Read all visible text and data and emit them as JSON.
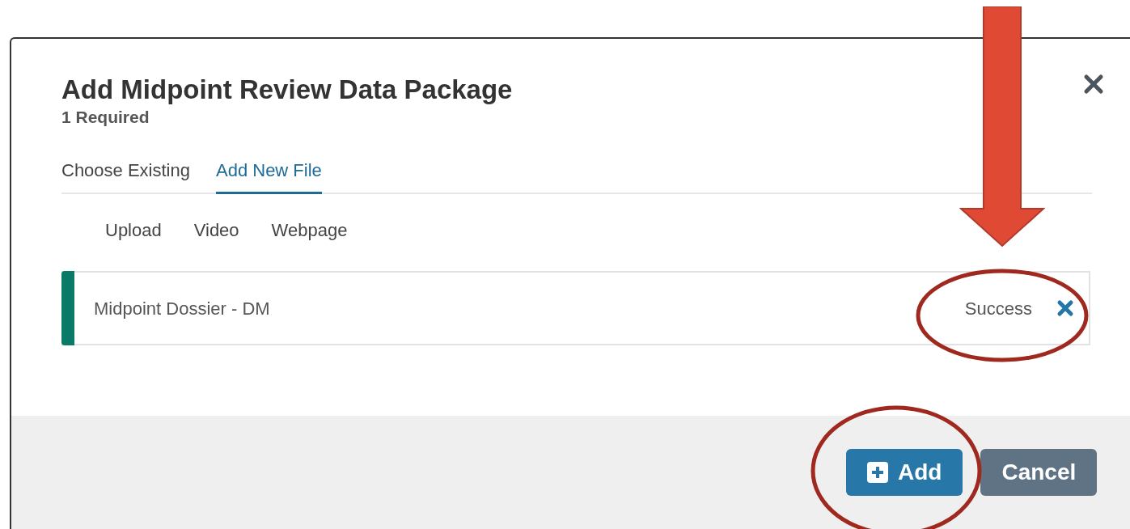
{
  "dialog": {
    "title": "Add Midpoint Review Data Package",
    "subtitle": "1 Required",
    "tabs": [
      {
        "label": "Choose Existing",
        "selected": false
      },
      {
        "label": "Add New File",
        "selected": true
      }
    ],
    "source_options": [
      "Upload",
      "Video",
      "Webpage"
    ],
    "files": [
      {
        "name": "Midpoint Dossier - DM",
        "status": "Success"
      }
    ],
    "buttons": [
      {
        "label": "Add",
        "kind": "primary"
      },
      {
        "label": "Cancel",
        "kind": "secondary"
      }
    ]
  }
}
